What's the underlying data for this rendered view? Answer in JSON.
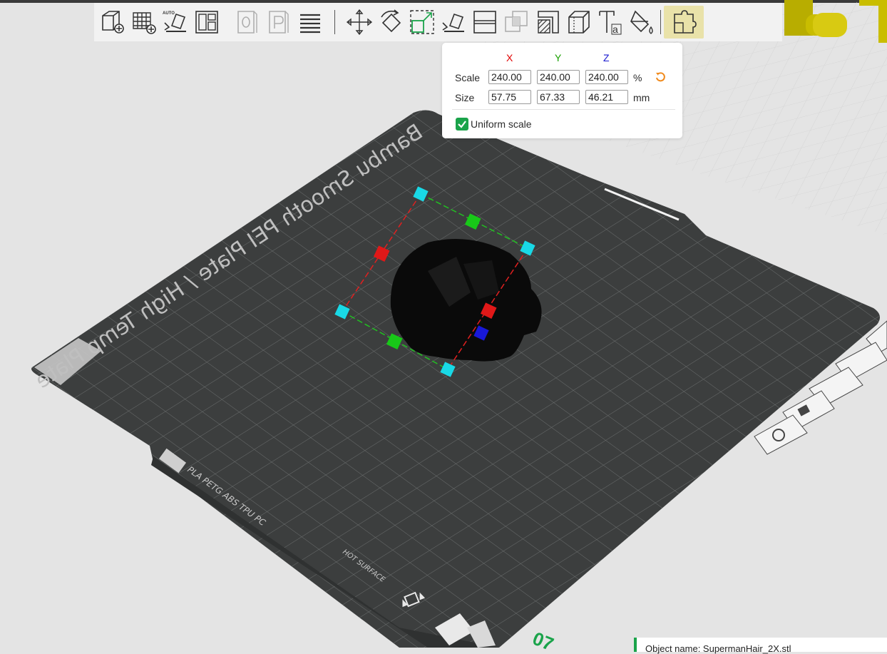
{
  "toolbar": {
    "buttons": [
      {
        "name": "add-object",
        "icon": "cube-plus-icon",
        "disabled": false
      },
      {
        "name": "add-plate",
        "icon": "grid-plus-icon",
        "disabled": false
      },
      {
        "name": "auto-orient",
        "icon": "auto-orient-icon",
        "disabled": false,
        "badge": "AUTO"
      },
      {
        "name": "arrange",
        "icon": "arrange-icon",
        "disabled": false
      },
      {
        "name": "split-objects",
        "icon": "split-objects-icon",
        "disabled": true,
        "badge": "O"
      },
      {
        "name": "split-parts",
        "icon": "split-parts-icon",
        "disabled": true,
        "badge": "P"
      },
      {
        "name": "layers-editing",
        "icon": "layers-icon",
        "disabled": false
      }
    ],
    "gizmos": [
      {
        "name": "move",
        "icon": "move-icon",
        "active": false
      },
      {
        "name": "rotate",
        "icon": "rotate-icon",
        "active": false
      },
      {
        "name": "scale",
        "icon": "scale-icon",
        "active": false
      },
      {
        "name": "lay-on-face",
        "icon": "lay-on-face-icon",
        "active": false
      },
      {
        "name": "cut",
        "icon": "cut-icon",
        "active": false
      },
      {
        "name": "boolean",
        "icon": "boolean-icon",
        "active": false,
        "disabled": true
      },
      {
        "name": "support-paint",
        "icon": "support-paint-icon",
        "active": false
      },
      {
        "name": "seam-paint",
        "icon": "seam-paint-icon",
        "active": false
      },
      {
        "name": "text",
        "icon": "text-icon",
        "active": false
      },
      {
        "name": "color-paint",
        "icon": "color-paint-icon",
        "active": false
      },
      {
        "name": "assembly",
        "icon": "assembly-icon",
        "active": true
      }
    ]
  },
  "scale_panel": {
    "axes": {
      "x": "X",
      "y": "Y",
      "z": "Z"
    },
    "scale_label": "Scale",
    "size_label": "Size",
    "scale": {
      "x": "240.00",
      "y": "240.00",
      "z": "240.00"
    },
    "size": {
      "x": "57.75",
      "y": "67.33",
      "z": "46.21"
    },
    "scale_unit": "%",
    "size_unit": "mm",
    "uniform_scale_label": "Uniform scale",
    "uniform_scale_checked": true
  },
  "plate": {
    "name_text": "Bambu Smooth PEI Plate / High Temp Plate",
    "materials_text": "PLA PETG ABS TPU PC",
    "warning_text": "HOT SURFACE"
  },
  "status": {
    "object_name": "Object name: SupermanHair_2X.stl"
  },
  "colors": {
    "accent_green": "#1aa34a",
    "axis_x": "#e00000",
    "axis_y": "#1aa000",
    "axis_z": "#1a1ad0",
    "plate": "#3c3e3e",
    "handle_cyan": "#19d9e6"
  }
}
